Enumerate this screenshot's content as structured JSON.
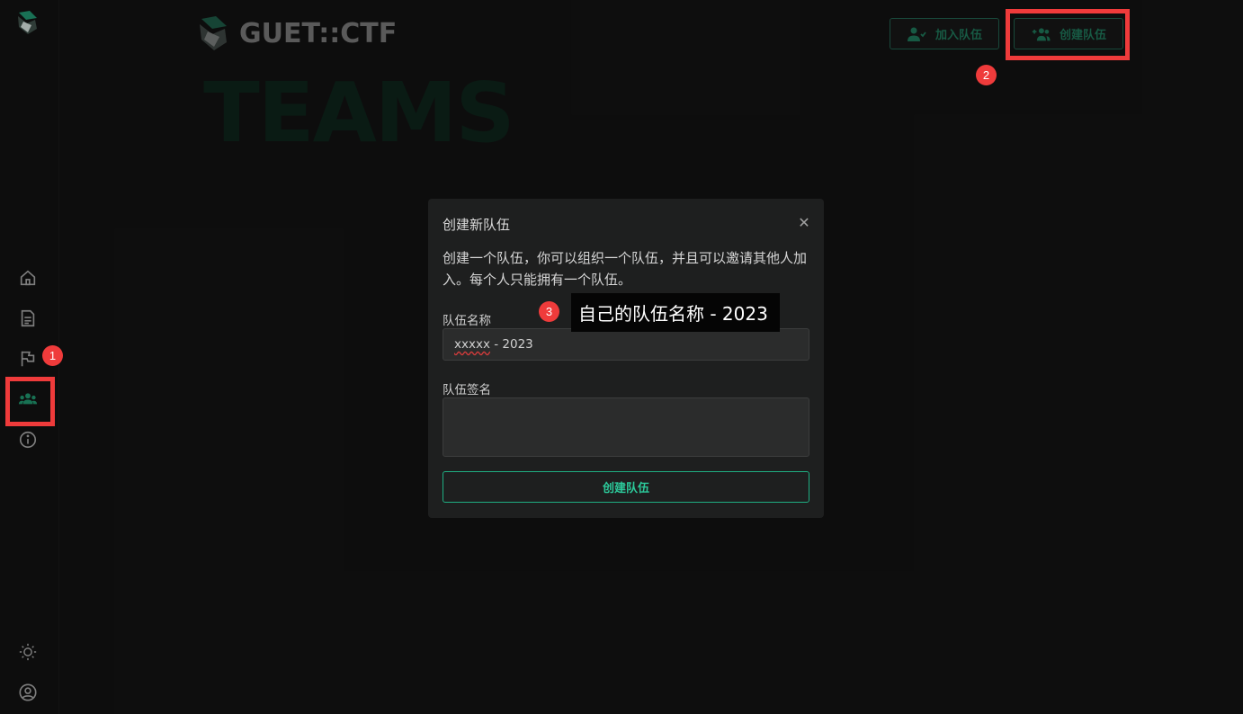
{
  "brand": {
    "name": "GUET::CTF"
  },
  "page": {
    "background_title": "TEAMS"
  },
  "header": {
    "join_team_label": "加入队伍",
    "create_team_label": "创建队伍"
  },
  "sidebar": {
    "items": [
      {
        "icon": "home-icon"
      },
      {
        "icon": "document-icon"
      },
      {
        "icon": "flag-icon"
      },
      {
        "icon": "team-icon",
        "active": true
      },
      {
        "icon": "info-icon"
      }
    ],
    "bottom": [
      {
        "icon": "theme-toggle-icon"
      },
      {
        "icon": "user-account-icon"
      }
    ]
  },
  "modal": {
    "title": "创建新队伍",
    "description": "创建一个队伍，你可以组织一个队伍，并且可以邀请其他人加入。每个人只能拥有一个队伍。",
    "team_name_label": "队伍名称",
    "team_name_value_prefix": "xxxxx",
    "team_name_value_suffix": " - 2023",
    "team_signature_label": "队伍签名",
    "team_signature_value": "",
    "submit_label": "创建队伍"
  },
  "annotations": {
    "badge_1": "1",
    "badge_2": "2",
    "badge_3": "3",
    "tooltip_3": "自己的队伍名称 - 2023"
  },
  "colors": {
    "accent": "#2cc99a",
    "accent_dark": "#1d6e53",
    "annotation_red": "#ef3b3b",
    "background": "#111111",
    "modal_bg": "#1e1f1f"
  }
}
